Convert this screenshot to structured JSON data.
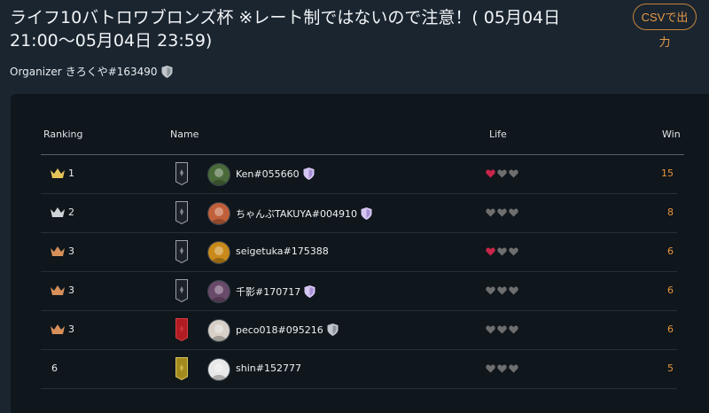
{
  "header": {
    "title": "ライフ10バトロワブロンズ杯 ※レート制ではないので注意！( 05月04日 21:00〜05月04日 23:59)",
    "csv_button": "CSVで出力"
  },
  "organizer": {
    "label": "Organizer",
    "name": "きろくや#163490"
  },
  "table": {
    "columns": {
      "ranking": "Ranking",
      "name": "Name",
      "life": "Life",
      "win": "Win"
    },
    "rows": [
      {
        "rank": "1",
        "crown": "gold",
        "banner": "dark",
        "avatar": "#4a6a3a",
        "name": "Ken#055660",
        "badge": "purple",
        "hearts": [
          "red",
          "gray",
          "gray"
        ],
        "win": "15"
      },
      {
        "rank": "2",
        "crown": "silver",
        "banner": "dark",
        "avatar": "#c0603a",
        "name": "ちゃんぷTAKUYA#004910",
        "badge": "purple",
        "hearts": [
          "gray",
          "gray",
          "gray"
        ],
        "win": "8"
      },
      {
        "rank": "3",
        "crown": "bronze",
        "banner": "dark",
        "avatar": "#c88a1a",
        "name": "seigetuka#175388",
        "badge": "",
        "hearts": [
          "red",
          "gray",
          "gray"
        ],
        "win": "6"
      },
      {
        "rank": "3",
        "crown": "bronze",
        "banner": "dark",
        "avatar": "#6a4a6a",
        "name": "千影#170717",
        "badge": "purple",
        "hearts": [
          "gray",
          "gray",
          "gray"
        ],
        "win": "6"
      },
      {
        "rank": "3",
        "crown": "bronze",
        "banner": "red",
        "avatar": "#d8d0c8",
        "name": "peco018#095216",
        "badge": "gray",
        "hearts": [
          "gray",
          "gray",
          "gray"
        ],
        "win": "6"
      },
      {
        "rank": "6",
        "crown": "",
        "banner": "gold",
        "avatar": "#e8e8e8",
        "name": "shin#152777",
        "badge": "",
        "hearts": [
          "gray",
          "gray",
          "gray"
        ],
        "win": "5"
      }
    ]
  },
  "colors": {
    "accent": "#e8963c",
    "heart_red": "#c8264a",
    "heart_gray": "#6e6e6e",
    "crown_gold": "#e6c25a",
    "crown_silver": "#cfd4d8",
    "crown_bronze": "#d8905a"
  }
}
